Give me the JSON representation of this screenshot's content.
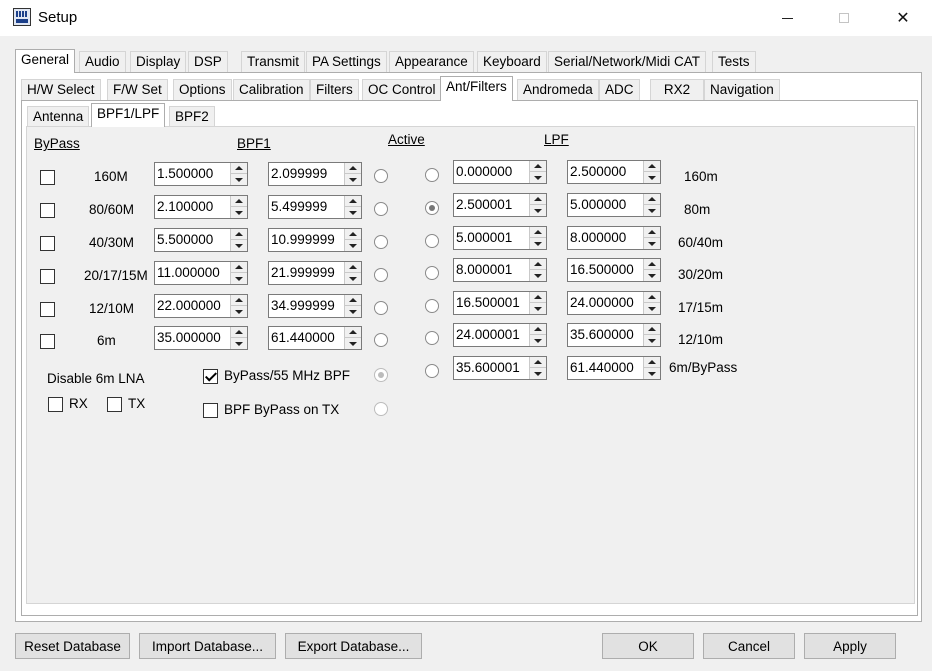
{
  "window": {
    "title": "Setup"
  },
  "tabs_main": [
    "General",
    "Audio",
    "Display",
    "DSP",
    "Transmit",
    "PA Settings",
    "Appearance",
    "Keyboard",
    "Serial/Network/Midi CAT",
    "Tests"
  ],
  "tabs_sub": [
    "H/W Select",
    "F/W Set",
    "Options",
    "Calibration",
    "Filters",
    "OC Control",
    "Ant/Filters",
    "Andromeda",
    "ADC",
    "RX2",
    "Navigation"
  ],
  "tabs_inner": [
    "Antenna",
    "BPF1/LPF",
    "BPF2"
  ],
  "headers": {
    "bypass": "ByPass",
    "bpf1": "BPF1",
    "active": "Active",
    "lpf": "LPF"
  },
  "bpf_rows": [
    {
      "band": "160M",
      "low": "1.500000",
      "high": "2.099999"
    },
    {
      "band": "80/60M",
      "low": "2.100000",
      "high": "5.499999"
    },
    {
      "band": "40/30M",
      "low": "5.500000",
      "high": "10.999999"
    },
    {
      "band": "20/17/15M",
      "low": "11.000000",
      "high": "21.999999"
    },
    {
      "band": "12/10M",
      "low": "22.000000",
      "high": "34.999999"
    },
    {
      "band": "6m",
      "low": "35.000000",
      "high": "61.440000"
    }
  ],
  "lpf_rows": [
    {
      "low": "0.000000",
      "high": "2.500000",
      "band": "160m"
    },
    {
      "low": "2.500001",
      "high": "5.000000",
      "band": "80m"
    },
    {
      "low": "5.000001",
      "high": "8.000000",
      "band": "60/40m"
    },
    {
      "low": "8.000001",
      "high": "16.500000",
      "band": "30/20m"
    },
    {
      "low": "16.500001",
      "high": "24.000000",
      "band": "17/15m"
    },
    {
      "low": "24.000001",
      "high": "35.600000",
      "band": "12/10m"
    },
    {
      "low": "35.600001",
      "high": "61.440000",
      "band": "6m/ByPass"
    }
  ],
  "lpf_active_index": 1,
  "disable_lna": {
    "label": "Disable 6m LNA",
    "rx": "RX",
    "tx": "TX"
  },
  "bypass55": {
    "label": "ByPass/55 MHz BPF",
    "checked": true
  },
  "bpf_bypass_tx": {
    "label": "BPF ByPass on TX",
    "checked": false
  },
  "buttons": {
    "reset": "Reset Database",
    "import": "Import Database...",
    "export": "Export Database...",
    "ok": "OK",
    "cancel": "Cancel",
    "apply": "Apply"
  }
}
